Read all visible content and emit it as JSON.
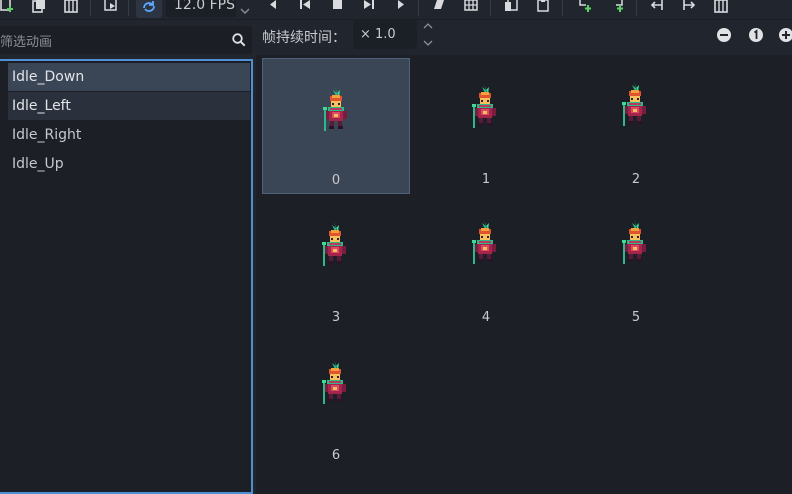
{
  "toolbar": {
    "fps": "12.0 FPS",
    "icons": [
      "add-animation-icon",
      "duplicate-animation-icon",
      "delete-animation-icon",
      "autoplay-icon",
      "loop-icon",
      "play-backwards-from-end-icon",
      "play-backwards-icon",
      "stop-icon",
      "play-icon",
      "play-from-start-icon",
      "load-file-icon",
      "load-spritesheet-icon",
      "copy-frame-icon",
      "paste-frame-icon",
      "insert-before-icon",
      "insert-after-icon",
      "move-left-icon",
      "move-right-icon",
      "delete-frame-icon"
    ]
  },
  "left": {
    "filter_placeholder": "筛选动画",
    "animations": [
      "Idle_Down",
      "Idle_Left",
      "Idle_Right",
      "Idle_Up"
    ],
    "selected": "Idle_Down"
  },
  "right": {
    "duration_label": "帧持续时间：",
    "duration_value": "× 1.0",
    "frames": [
      "0",
      "1",
      "2",
      "3",
      "4",
      "5",
      "6"
    ],
    "selected_frame": "0"
  },
  "colors": {
    "background": "#21262e",
    "panel": "#1c1f26",
    "accent": "#4f8fd6",
    "selection": "#3a4555"
  }
}
